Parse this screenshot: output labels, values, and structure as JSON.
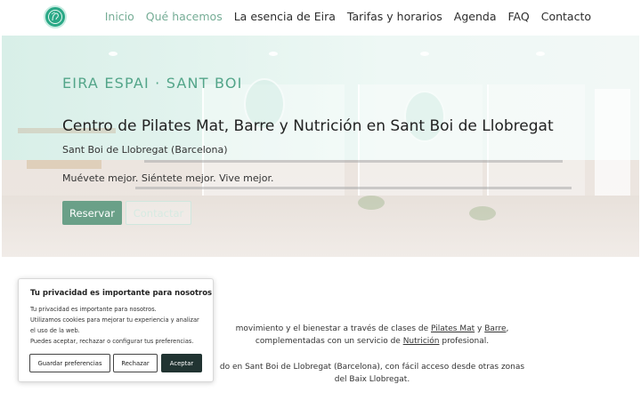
{
  "header": {
    "logo_icon": "eira-logo-icon",
    "nav": [
      {
        "label": "Inicio",
        "active": true
      },
      {
        "label": "Qué hacemos",
        "active": true
      },
      {
        "label": "La esencia de Eira",
        "active": false
      },
      {
        "label": "Tarifas y horarios",
        "active": false
      },
      {
        "label": "Agenda",
        "active": false
      },
      {
        "label": "FAQ",
        "active": false
      },
      {
        "label": "Contacto",
        "active": false
      }
    ]
  },
  "hero": {
    "brand": "EIRA ESPAI · SANT BOI",
    "title": "Centro de Pilates Mat, Barre y Nutrición en Sant Boi de Llobregat",
    "location": "Sant Boi de Llobregat (Barcelona)",
    "tagline": "Muévete mejor. Siéntete mejor. Vive mejor.",
    "reserve_label": "Reservar",
    "contact_label": "Contactar"
  },
  "body": {
    "p1_before": "movimiento y el bienestar a través de clases de ",
    "p1_link1": "Pilates Mat",
    "p1_mid": " y ",
    "p1_link2": "Barre",
    "p1_after": ", complementadas con un servicio de ",
    "p1_link3": "Nutrición",
    "p1_end": " profesional.",
    "p2": "do en Sant Boi de Llobregat (Barcelona), con fácil acceso desde otras zonas del Baix Llobregat."
  },
  "cookie": {
    "title": "Tu privacidad es importante para nosotros",
    "lines": [
      "Tu privacidad es importante para nosotros.",
      "Utilizamos cookies para mejorar tu experiencia y analizar",
      "el uso de la web.",
      "Puedes aceptar, rechazar o configurar tus preferencias."
    ],
    "prefs_label": "Guardar preferencias",
    "reject_label": "Rechazar",
    "accept_label": "Aceptar"
  },
  "colors": {
    "accent": "#6aa088",
    "nav_active": "#76ad96",
    "brand_text": "#53a589",
    "cookie_accept": "#213432"
  }
}
